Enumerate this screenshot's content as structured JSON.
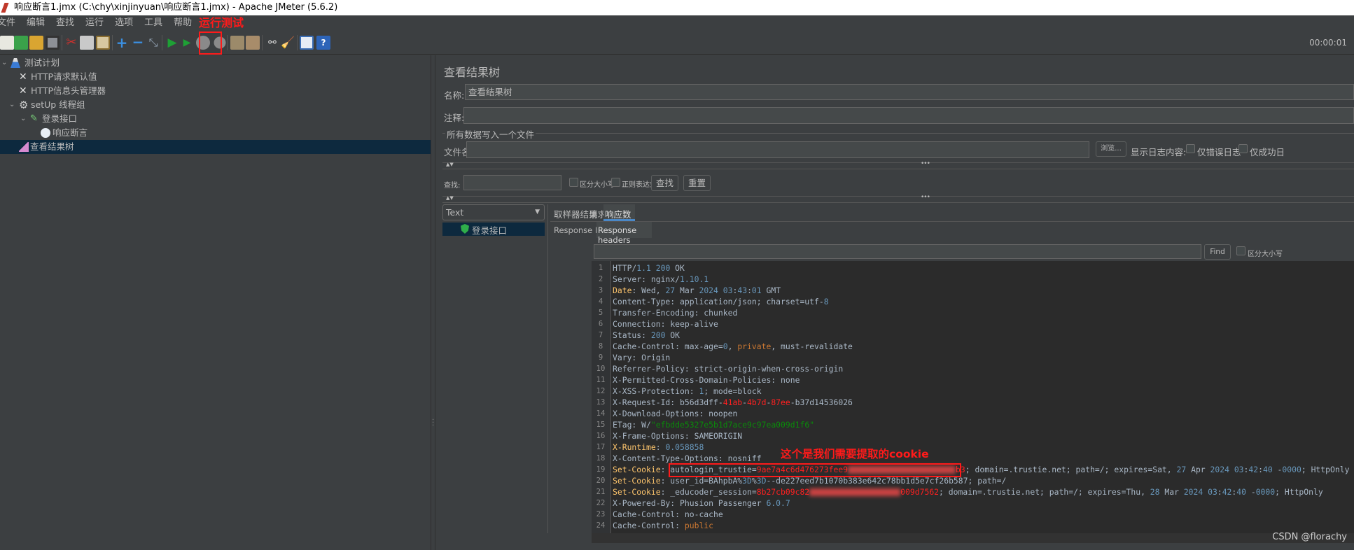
{
  "window": {
    "title": "响应断言1.jmx (C:\\chy\\xinjinyuan\\响应断言1.jmx) - Apache JMeter (5.6.2)"
  },
  "menu": [
    "文件",
    "编辑",
    "查找",
    "运行",
    "选项",
    "工具",
    "帮助"
  ],
  "annotations": {
    "run_test": "运行测试",
    "cookie_note": "这个是我们需要提取的cookie",
    "accent": "#ff1a1a"
  },
  "toolbar": {
    "icons": [
      "new-icon",
      "templates-icon",
      "open-icon",
      "save-icon",
      "cut-icon",
      "copy-icon",
      "paste-icon",
      "expand-icon",
      "collapse-icon",
      "toggle-icon",
      "start-icon",
      "start-no-pause-icon",
      "stop-icon",
      "shutdown-icon",
      "clear-icon",
      "clear-all-icon",
      "search-icon",
      "reset-search-icon",
      "function-helper-icon",
      "help-icon"
    ],
    "timer": "00:00:01"
  },
  "tree": {
    "items": [
      {
        "label": "测试计划",
        "icon": "test-plan-icon"
      },
      {
        "label": "HTTP请求默认值",
        "icon": "config-icon"
      },
      {
        "label": "HTTP信息头管理器",
        "icon": "config-icon"
      },
      {
        "label": "setUp 线程组",
        "icon": "gear-icon"
      },
      {
        "label": "登录接口",
        "icon": "sampler-icon"
      },
      {
        "label": "响应断言",
        "icon": "assertion-icon"
      },
      {
        "label": "查看结果树",
        "icon": "listener-icon",
        "selected": true
      }
    ]
  },
  "panel": {
    "title": "查看结果树",
    "name_label": "名称:",
    "name_value": "查看结果树",
    "comment_label": "注释:",
    "comment_value": "",
    "file_group": "所有数据写入一个文件",
    "filename_label": "文件名",
    "filename_value": "",
    "browse": "浏览...",
    "log_label": "显示日志内容:",
    "errors_only": "仅错误日志",
    "success_only": "仅成功日",
    "search_label": "查找:",
    "case_sensitive": "区分大小写",
    "regex": "正则表达式",
    "search_btn": "查找",
    "reset_btn": "重置",
    "renderer": "Text",
    "results": [
      {
        "label": "登录接口",
        "status": "success"
      }
    ],
    "tabs": [
      "取样器结果",
      "请求",
      "响应数据"
    ],
    "active_tab": "响应数据",
    "subtabs": [
      "Response Body",
      "Response headers"
    ],
    "active_subtab": "Response headers",
    "find_btn": "Find",
    "find_case": "区分大小写"
  },
  "code_lines": [
    [
      [
        "HTTP/",
        "k"
      ],
      [
        "1.1 200",
        "n"
      ],
      [
        " OK",
        "k"
      ]
    ],
    [
      [
        "Server: nginx/",
        "k"
      ],
      [
        "1.10.1",
        "n"
      ]
    ],
    [
      [
        "Date",
        "y"
      ],
      [
        ": Wed, ",
        "k"
      ],
      [
        "27",
        "n"
      ],
      [
        " Mar ",
        "k"
      ],
      [
        "2024 03",
        "n"
      ],
      [
        ":",
        "k"
      ],
      [
        "43",
        "n"
      ],
      [
        ":",
        "k"
      ],
      [
        "01",
        "n"
      ],
      [
        " GMT",
        "k"
      ]
    ],
    [
      [
        "Content-Type: application/json; charset=utf-",
        "k"
      ],
      [
        "8",
        "n"
      ]
    ],
    [
      [
        "Transfer-Encoding: chunked",
        "k"
      ]
    ],
    [
      [
        "Connection: keep-alive",
        "k"
      ]
    ],
    [
      [
        "Status: ",
        "k"
      ],
      [
        "200",
        "n"
      ],
      [
        " OK",
        "k"
      ]
    ],
    [
      [
        "Cache-Control: max-age=",
        "k"
      ],
      [
        "0",
        "n"
      ],
      [
        ", ",
        "k"
      ],
      [
        "private",
        "o"
      ],
      [
        ", must-revalidate",
        "k"
      ]
    ],
    [
      [
        "Vary: Origin",
        "k"
      ]
    ],
    [
      [
        "Referrer-Policy: strict-origin-when-cross-origin",
        "k"
      ]
    ],
    [
      [
        "X-Permitted-Cross-Domain-Policies: none",
        "k"
      ]
    ],
    [
      [
        "X-XSS-Protection: ",
        "k"
      ],
      [
        "1",
        "n"
      ],
      [
        "; mode=block",
        "k"
      ]
    ],
    [
      [
        "X-Request-Id: b56d3dff-",
        "k"
      ],
      [
        "41ab",
        "r"
      ],
      [
        "-",
        "k"
      ],
      [
        "4b7d",
        "r"
      ],
      [
        "-",
        "k"
      ],
      [
        "87ee",
        "r"
      ],
      [
        "-b37d14536026",
        "k"
      ]
    ],
    [
      [
        "X-Download-Options: noopen",
        "k"
      ]
    ],
    [
      [
        "ETag: W/",
        "k"
      ],
      [
        "\"efbdde5327e5b1d7ace9c97ea009d1f6\"",
        "g"
      ]
    ],
    [
      [
        "X-Frame-Options: SAMEORIGIN",
        "k"
      ]
    ],
    [
      [
        "X-Runtime",
        "y"
      ],
      [
        ": ",
        "k"
      ],
      [
        "0.058858",
        "n"
      ]
    ],
    [
      [
        "X-Content-Type-Options: nosniff",
        "k"
      ]
    ],
    [
      [
        "Set-Cookie",
        "y"
      ],
      [
        ": autologin_trustie=",
        "k"
      ],
      [
        "9ae7a4c6d476273fee9",
        "r"
      ],
      [
        "",
        "blur"
      ],
      [
        "b3",
        "r"
      ],
      [
        "; domain=.trustie.net; path=/; expires=Sat, ",
        "k"
      ],
      [
        "27",
        "n"
      ],
      [
        " Apr ",
        "k"
      ],
      [
        "2024 03",
        "n"
      ],
      [
        ":",
        "k"
      ],
      [
        "42",
        "n"
      ],
      [
        ":",
        "k"
      ],
      [
        "40",
        "n"
      ],
      [
        " -",
        "k"
      ],
      [
        "0000",
        "n"
      ],
      [
        "; HttpOnly",
        "k"
      ]
    ],
    [
      [
        "Set-Cookie",
        "y"
      ],
      [
        ": user_id=BAhpbA%",
        "k"
      ],
      [
        "3D",
        "n"
      ],
      [
        "%",
        "k"
      ],
      [
        "3D",
        "n"
      ],
      [
        "--de227eed7b1070b383e642c78bb1d5e7cf26b587; path=/",
        "k"
      ]
    ],
    [
      [
        "Set-Cookie",
        "y"
      ],
      [
        ": _educoder_session=",
        "k"
      ],
      [
        "8b27cb09c82",
        "r"
      ],
      [
        "",
        "blur"
      ],
      [
        "009d7562",
        "r"
      ],
      [
        "; domain=.trustie.net; path=/; expires=Thu, ",
        "k"
      ],
      [
        "28",
        "n"
      ],
      [
        " Mar ",
        "k"
      ],
      [
        "2024 03",
        "n"
      ],
      [
        ":",
        "k"
      ],
      [
        "42",
        "n"
      ],
      [
        ":",
        "k"
      ],
      [
        "40",
        "n"
      ],
      [
        " -",
        "k"
      ],
      [
        "0000",
        "n"
      ],
      [
        "; HttpOnly",
        "k"
      ]
    ],
    [
      [
        "X-Powered-By: Phusion Passenger ",
        "k"
      ],
      [
        "6.0.7",
        "n"
      ]
    ],
    [
      [
        "Cache-Control: no-cache",
        "k"
      ]
    ],
    [
      [
        "Cache-Control: ",
        "k"
      ],
      [
        "public",
        "o"
      ]
    ],
    []
  ],
  "watermark": "CSDN @florachy"
}
